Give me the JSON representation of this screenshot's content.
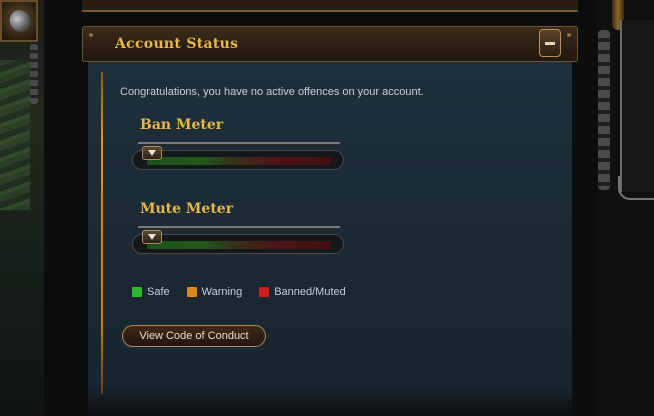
{
  "panel": {
    "title": "Account Status",
    "collapse_icon": "minus-icon",
    "intro_text": "Congratulations, you have no active offences on your account."
  },
  "meters": [
    {
      "title": "Ban Meter",
      "level": 0
    },
    {
      "title": "Mute Meter",
      "level": 0
    }
  ],
  "legend": [
    {
      "label": "Safe",
      "color": "#2eb82e"
    },
    {
      "label": "Warning",
      "color": "#d98a1a"
    },
    {
      "label": "Banned/Muted",
      "color": "#cc2020"
    }
  ],
  "actions": {
    "conduct_button": "View Code of Conduct"
  },
  "colors": {
    "accent_gold": "#e8b84a",
    "panel_bg": "#1b2a35"
  }
}
